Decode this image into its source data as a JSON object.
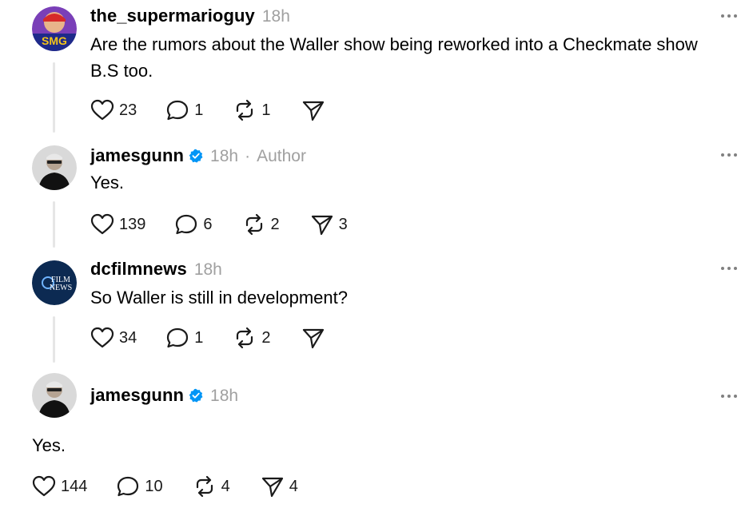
{
  "posts": [
    {
      "username": "the_supermarioguy",
      "time": "18h",
      "verified": false,
      "author": "",
      "text": "Are the rumors about the Waller show being reworked into a Checkmate show B.S too.",
      "likes": "23",
      "comments": "1",
      "reposts": "1",
      "shares": "",
      "avatar_label": "SMG"
    },
    {
      "username": "jamesgunn",
      "time": "18h",
      "verified": true,
      "author": "Author",
      "text": "Yes.",
      "likes": "139",
      "comments": "6",
      "reposts": "2",
      "shares": "3"
    },
    {
      "username": "dcfilmnews",
      "time": "18h",
      "verified": false,
      "author": "",
      "text": "So Waller is still in development?",
      "likes": "34",
      "comments": "1",
      "reposts": "2",
      "shares": "",
      "avatar_label_1": "FILM",
      "avatar_label_2": "NEWS"
    },
    {
      "username": "jamesgunn",
      "time": "18h",
      "verified": true,
      "author": "",
      "text": "Yes.",
      "likes": "144",
      "comments": "10",
      "reposts": "4",
      "shares": "4"
    }
  ],
  "separator": "·",
  "colors": {
    "verified": "#0095f6",
    "muted": "#a0a0a0",
    "thread_line": "#e6e6e6"
  },
  "icons": [
    "heart-icon",
    "comment-icon",
    "repost-icon",
    "share-icon",
    "more-icon",
    "verified-icon"
  ]
}
